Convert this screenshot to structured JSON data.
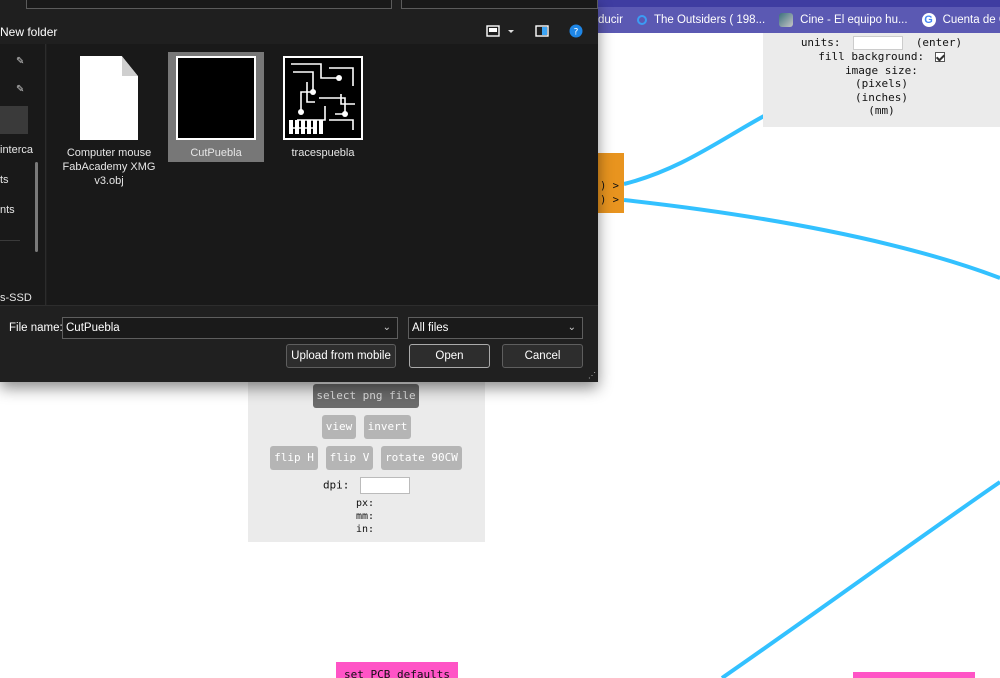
{
  "browser": {
    "bookmarks": [
      {
        "label": "ducir",
        "icon": "none"
      },
      {
        "label": "The Outsiders ( 198...",
        "icon": "search-icon"
      },
      {
        "label": "Cine - El equipo hu...",
        "icon": "image-icon"
      },
      {
        "label": "Cuenta de G",
        "icon": "google-icon"
      }
    ],
    "accent_color": "#5b59b3"
  },
  "image_size_panel": {
    "units_label": "units:",
    "enter_label": "(enter)",
    "fill_background_label": "fill background:",
    "fill_background_checked": true,
    "image_size_label": "image size:",
    "pixels_label": "(pixels)",
    "inches_label": "(inches)",
    "mm_label": "(mm)"
  },
  "orange_node": {
    "port1": ") >",
    "port2": ") >"
  },
  "png_panel": {
    "select_label": "select png file",
    "view_label": "view",
    "invert_label": "invert",
    "flip_h_label": "flip H",
    "flip_v_label": "flip V",
    "rotate_label": "rotate 90CW",
    "dpi_label": "dpi:",
    "px_label": "px:",
    "mm_label": "mm:",
    "in_label": "in:"
  },
  "pcb_defaults_label": "set PCB defaults",
  "dialog": {
    "new_folder_label": "New folder",
    "nav_items": [
      "interca",
      "ts",
      "nts",
      "s-SSD"
    ],
    "files": [
      {
        "name": "Computer mouse FabAcademy XMG v3.obj",
        "type": "document",
        "selected": false
      },
      {
        "name": "CutPuebla",
        "type": "black-image",
        "selected": true
      },
      {
        "name": "tracespuebla",
        "type": "trace-image",
        "selected": false
      }
    ],
    "file_name_label": "File name:",
    "file_name_value": "CutPuebla",
    "file_type_value": "All files",
    "upload_label": "Upload from mobile",
    "open_label": "Open",
    "cancel_label": "Cancel"
  },
  "wire_color": "#33c1ff"
}
